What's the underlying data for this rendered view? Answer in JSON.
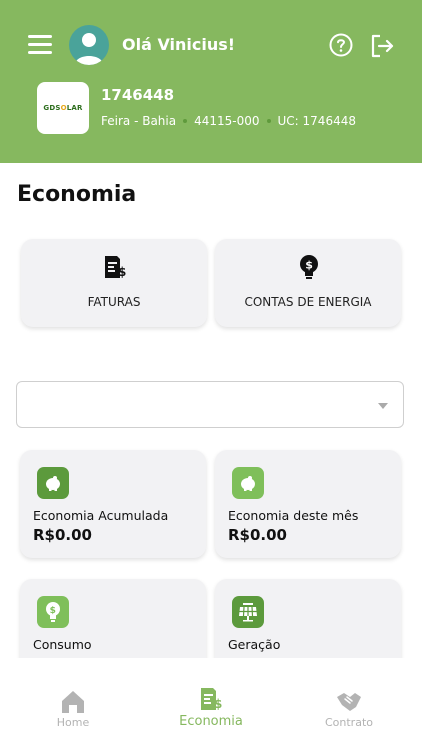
{
  "header": {
    "greeting": "Olá Vinicius!",
    "logo_text_prefix": "GDS",
    "logo_text_o": "O",
    "logo_text_suffix": "LAR",
    "uc_title": "1746448",
    "city": "Feira - Bahia",
    "cep": "44115-000",
    "uc_label": "UC: 1746448"
  },
  "page": {
    "title": "Economia"
  },
  "quick_links": [
    {
      "label": "FATURAS",
      "icon": "invoice-icon"
    },
    {
      "label": "CONTAS DE ENERGIA",
      "icon": "energy-bulb-icon"
    }
  ],
  "period_select": {
    "value": ""
  },
  "stats": [
    {
      "title": "Economia Acumulada",
      "value": "R$0.00",
      "icon": "piggy-bank-icon",
      "badge_color": "#5c9a3c"
    },
    {
      "title": "Economia deste mês",
      "value": "R$0.00",
      "icon": "piggy-bank-icon",
      "badge_color": "#7fbf5a"
    },
    {
      "title": "Consumo",
      "value": "",
      "icon": "lightbulb-dollar-icon",
      "badge_color": "#7fbf5a"
    },
    {
      "title": "Geração",
      "value": "",
      "icon": "solar-panel-icon",
      "badge_color": "#5c9a3c"
    }
  ],
  "bottom_nav": [
    {
      "label": "Home",
      "icon": "home-icon",
      "active": false
    },
    {
      "label": "Economia",
      "icon": "invoice-icon",
      "active": true
    },
    {
      "label": "Contrato",
      "icon": "handshake-icon",
      "active": false
    }
  ],
  "colors": {
    "primary": "#86b85f",
    "dark_green": "#5c9a3c",
    "card_bg": "#f2f2f4"
  }
}
